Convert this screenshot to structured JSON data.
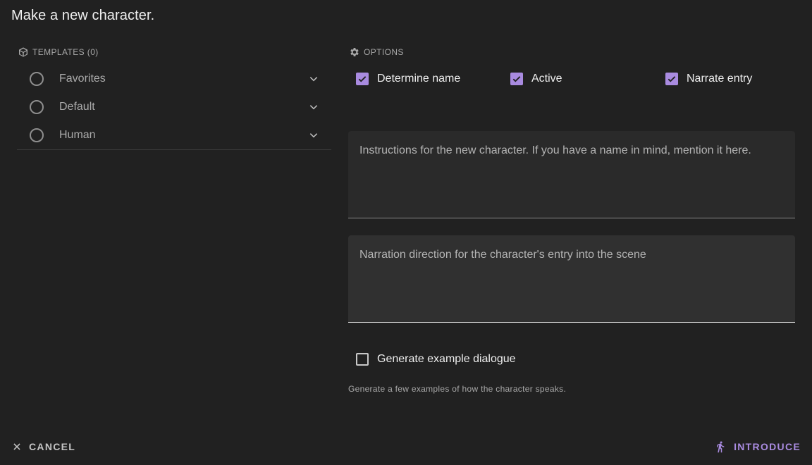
{
  "dialog": {
    "title": "Make a new character."
  },
  "templates": {
    "heading": "TEMPLATES (0)",
    "items": [
      {
        "label": "Favorites"
      },
      {
        "label": "Default"
      },
      {
        "label": "Human"
      }
    ]
  },
  "options": {
    "heading": "OPTIONS",
    "determine_name": {
      "label": "Determine name",
      "checked": true
    },
    "active": {
      "label": "Active",
      "checked": true
    },
    "narrate_entry": {
      "label": "Narrate entry",
      "checked": true
    },
    "instructions_placeholder": "Instructions for the new character. If you have a name in mind, mention it here.",
    "narration_placeholder": "Narration direction for the character's entry into the scene",
    "generate_dialogue": {
      "label": "Generate example dialogue",
      "checked": false
    },
    "generate_hint": "Generate a few examples of how the character speaks."
  },
  "actions": {
    "cancel_label": "Cancel",
    "introduce_label": "Introduce"
  },
  "colors": {
    "accent": "#a98be0",
    "background": "#212121"
  }
}
